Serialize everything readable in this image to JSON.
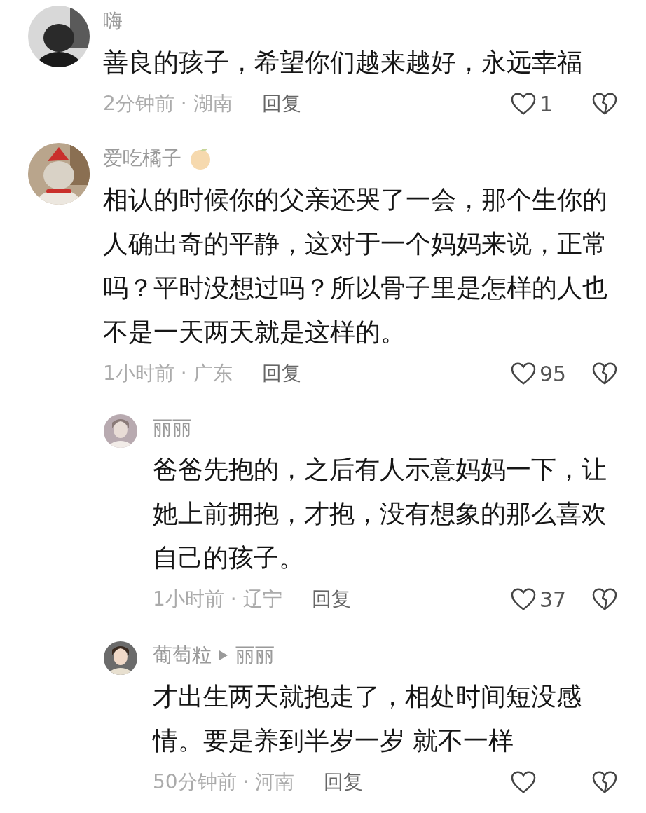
{
  "comments": [
    {
      "kind": "plain",
      "name": "嗨",
      "text": "善良的孩子，希望你们越来越好，永远幸福",
      "meta": "2分钟前 · 湖南",
      "reply_label": "回复",
      "likes": "1"
    },
    {
      "kind": "badged",
      "name": "爱吃橘子",
      "text": "相认的时候你的父亲还哭了一会，那个生你的人确出奇的平静，这对于一个妈妈来说，正常吗？平时没想过吗？所以骨子里是怎样的人也不是一天两天就是这样的。",
      "meta": "1小时前 · 广东",
      "reply_label": "回复",
      "likes": "95",
      "replies": [
        {
          "name": "丽丽",
          "text": "爸爸先抱的，之后有人示意妈妈一下，让她上前拥抱，才抱，没有想象的那么喜欢自己的孩子。",
          "meta": "1小时前 · 辽宁",
          "reply_label": "回复",
          "likes": "37"
        },
        {
          "name": "葡萄粒",
          "reply_to": "丽丽",
          "text": "才出生两天就抱走了，相处时间短没感情。要是养到半岁一岁 就不一样",
          "meta": "50分钟前 · 河南",
          "reply_label": "回复"
        }
      ]
    }
  ]
}
